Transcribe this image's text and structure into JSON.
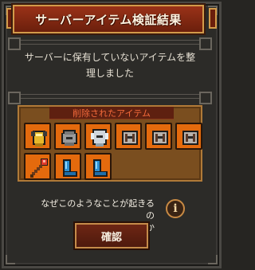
{
  "dialog": {
    "title": "サーバーアイテム検証結果",
    "message_line1": "サーバーに保有していないアイテムを整",
    "message_line2": "理しました"
  },
  "items_panel": {
    "header": "削除されたアイテム",
    "items": [
      {
        "icon": "gold-armor-icon"
      },
      {
        "icon": "steel-helmet-icon"
      },
      {
        "icon": "silver-helmet-icon"
      },
      {
        "icon": "iron-helmet-icon"
      },
      {
        "icon": "iron-helmet-icon"
      },
      {
        "icon": "iron-helmet-icon"
      },
      {
        "icon": "fire-staff-icon"
      },
      {
        "icon": "blue-boots-icon"
      },
      {
        "icon": "blue-boots-icon"
      }
    ]
  },
  "help": {
    "text_line1": "なぜこのようなことが起きるの",
    "text_line2": "ですか",
    "icon_glyph": "i"
  },
  "confirm_button": {
    "label": "確認"
  },
  "colors": {
    "title_bg": "#8a2a14",
    "panel_bg": "#7a4e1f",
    "slot_bg": "#e46a0d",
    "header_text": "#f36a3b"
  }
}
